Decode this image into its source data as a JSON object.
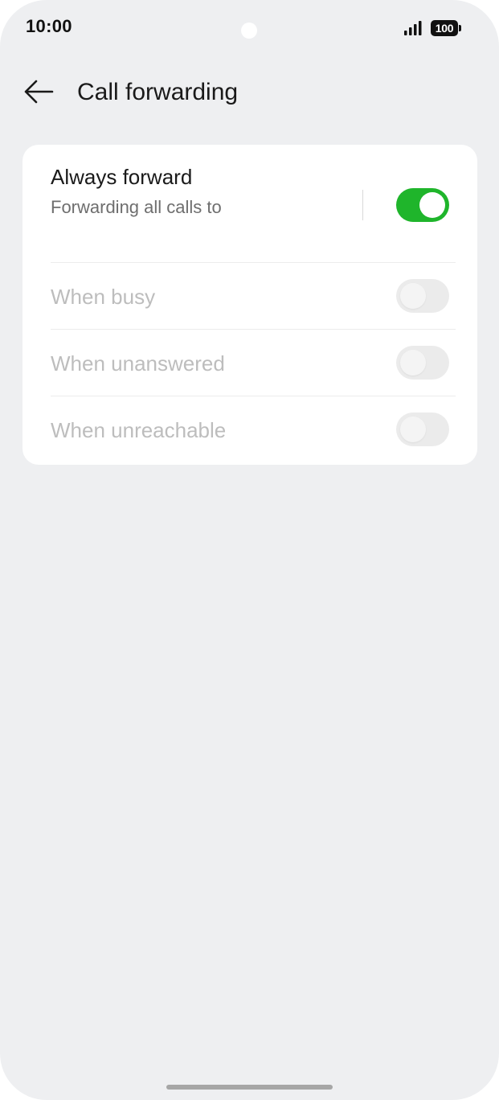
{
  "status_bar": {
    "time": "10:00",
    "battery": "100",
    "signal_icon": "cellular-signal-icon"
  },
  "app_bar": {
    "back_icon": "arrow-left-icon",
    "title": "Call forwarding"
  },
  "forwarding": {
    "always": {
      "title": "Always forward",
      "subtitle": "Forwarding all calls to",
      "enabled": true
    },
    "options": [
      {
        "label": "When busy",
        "enabled": false
      },
      {
        "label": "When unanswered",
        "enabled": false
      },
      {
        "label": "When unreachable",
        "enabled": false
      }
    ]
  },
  "colors": {
    "toggle_on": "#1fb52b",
    "toggle_off": "#ebebeb",
    "background": "#eeeff1",
    "disabled_text": "#bdbdbd"
  }
}
